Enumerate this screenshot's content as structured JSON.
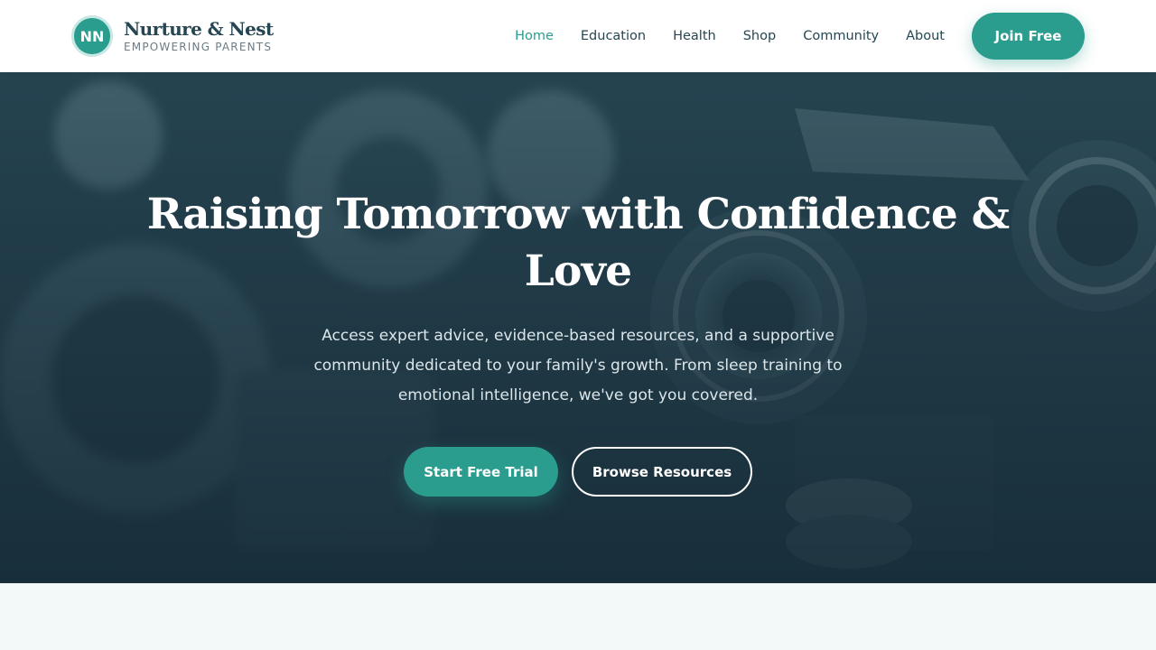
{
  "brand": {
    "logo_initials": "NN",
    "name": "Nurture & Nest",
    "tagline": "EMPOWERING PARENTS"
  },
  "nav": {
    "items": [
      {
        "label": "Home",
        "active": true
      },
      {
        "label": "Education",
        "active": false
      },
      {
        "label": "Health",
        "active": false
      },
      {
        "label": "Shop",
        "active": false
      },
      {
        "label": "Community",
        "active": false
      },
      {
        "label": "About",
        "active": false
      }
    ],
    "cta_label": "Join Free"
  },
  "hero": {
    "title": "Raising Tomorrow with Confidence & Love",
    "subtitle": "Access expert advice, evidence-based resources, and a supportive community dedicated to your family's growth. From sleep training to emotional intelligence, we've got you covered.",
    "primary_cta": "Start Free Trial",
    "secondary_cta": "Browse Resources",
    "background_image": "vintage-camera-photo"
  },
  "colors": {
    "accent": "#2a9d8f",
    "dark": "#264653",
    "page_bg": "#f3f8f8"
  }
}
